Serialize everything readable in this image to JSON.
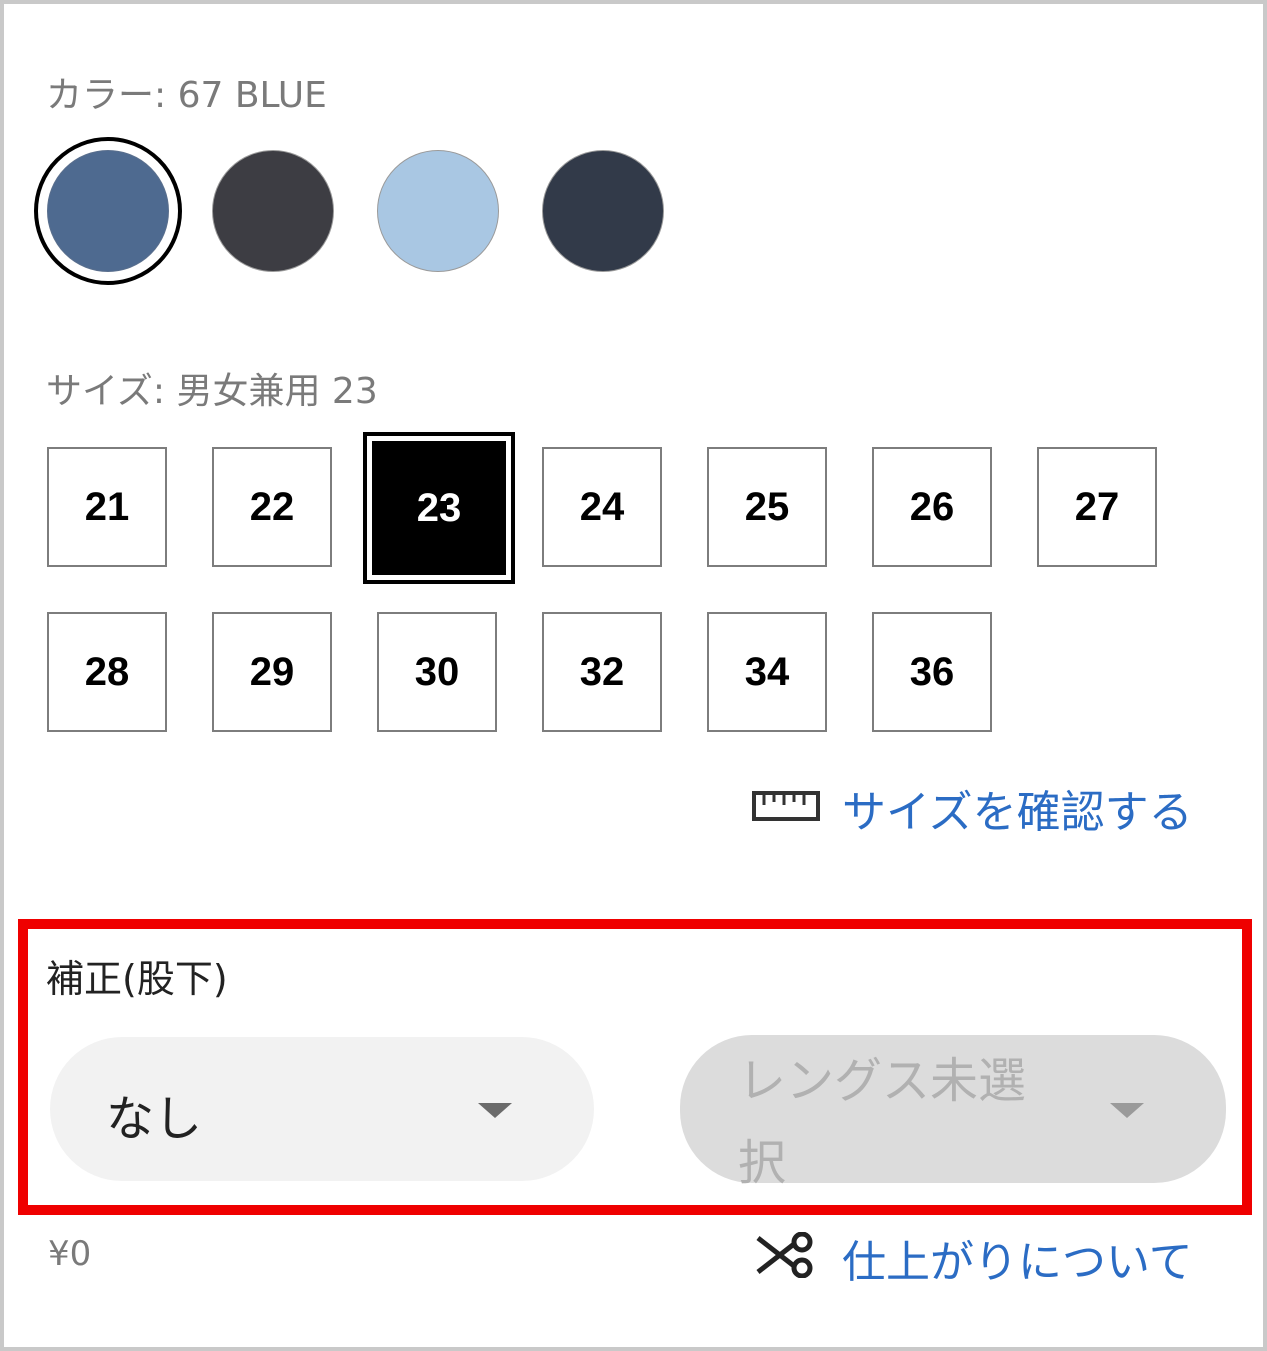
{
  "color": {
    "label": "カラー: 67 BLUE",
    "swatches": [
      {
        "name": "blue",
        "color": "#4e6a90",
        "selected": true
      },
      {
        "name": "dark-gray",
        "color": "#3d3d43",
        "selected": false
      },
      {
        "name": "light-blue",
        "color": "#a9c7e3",
        "selected": false
      },
      {
        "name": "navy",
        "color": "#323a49",
        "selected": false
      }
    ]
  },
  "size": {
    "label": "サイズ: 男女兼用 23",
    "options": [
      "21",
      "22",
      "23",
      "24",
      "25",
      "26",
      "27",
      "28",
      "29",
      "30",
      "32",
      "34",
      "36"
    ],
    "selected": "23",
    "check_link": "サイズを確認する",
    "check_icon": "ruler-icon"
  },
  "alteration": {
    "label": "補正(股下)",
    "select_value": "なし",
    "length_placeholder": "レングス未選択",
    "length_line1": "レングス未選",
    "length_line2": "択",
    "highlight_color": "#ef0000"
  },
  "footer": {
    "price": "¥0",
    "finish_link": "仕上がりについて",
    "finish_icon": "scissors-icon"
  },
  "colors": {
    "link": "#2b6cc4",
    "muted_text": "#7a7a7a",
    "select_bg": "#f2f2f2",
    "disabled_bg": "#dcdcdc"
  }
}
